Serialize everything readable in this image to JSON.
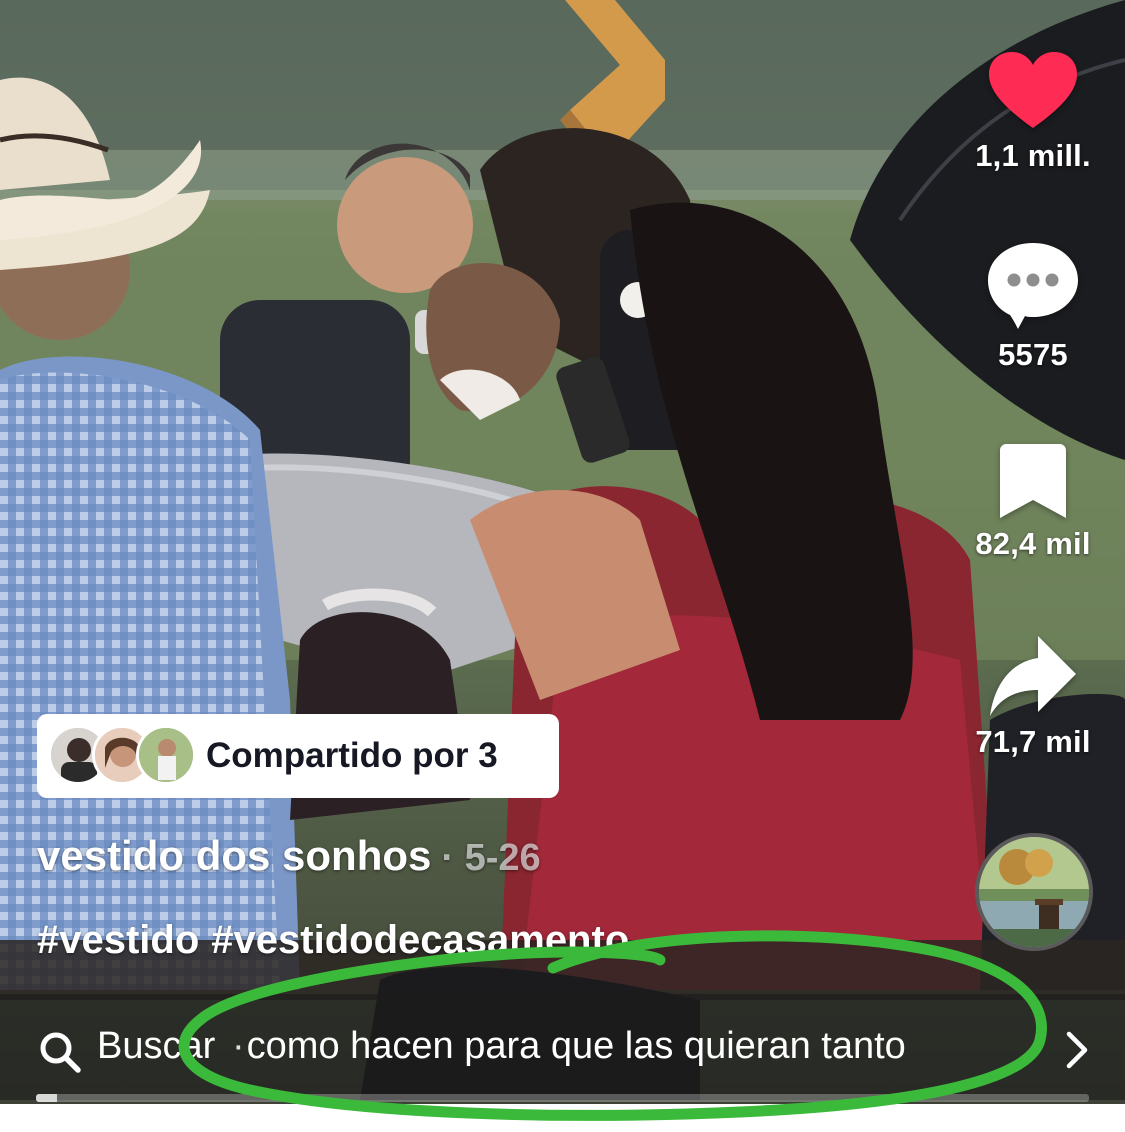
{
  "actions": {
    "like_count": "1,1 mill.",
    "comment_count": "5575",
    "save_count": "82,4 mil",
    "share_count": "71,7 mil"
  },
  "shared_by": {
    "label": "Compartido por 3"
  },
  "caption": {
    "author": "vestido dos sonhos",
    "date": "· 5-26",
    "hashtags": [
      "#vestido",
      "#vestidodecasamento"
    ]
  },
  "search_bar": {
    "label": "Buscar",
    "separator": "·",
    "query": "como hacen para que las quieran tanto"
  },
  "video": {
    "progress": 0.02
  },
  "colors": {
    "like_red": "#fe2c55",
    "annotation_green": "#3bb93a",
    "chip_bg": "#ffffff"
  },
  "icons": [
    "heart-icon",
    "comment-icon",
    "bookmark-icon",
    "share-icon",
    "search-icon",
    "chevron-right-icon"
  ]
}
